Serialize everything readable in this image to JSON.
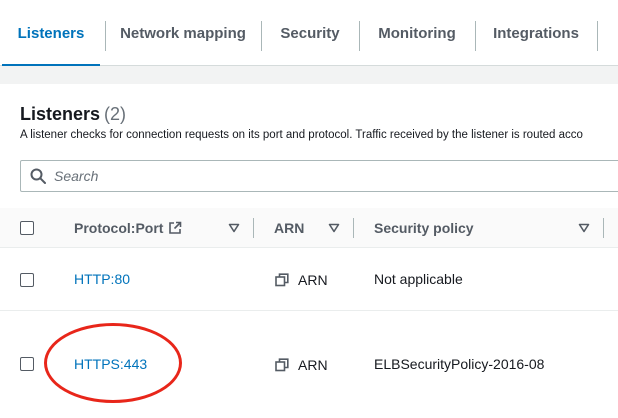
{
  "tabs": [
    {
      "label": "Listeners",
      "active": true
    },
    {
      "label": "Network mapping",
      "active": false
    },
    {
      "label": "Security",
      "active": false
    },
    {
      "label": "Monitoring",
      "active": false
    },
    {
      "label": "Integrations",
      "active": false
    }
  ],
  "listeners": {
    "title": "Listeners",
    "count": "(2)",
    "description": "A listener checks for connection requests on its port and protocol. Traffic received by the listener is routed acco",
    "search_placeholder": "Search"
  },
  "table": {
    "columns": {
      "protocol_port": "Protocol:Port",
      "arn": "ARN",
      "security_policy": "Security policy"
    },
    "rows": [
      {
        "protocol_port": "HTTP:80",
        "arn": "ARN",
        "security_policy": "Not applicable"
      },
      {
        "protocol_port": "HTTPS:443",
        "arn": "ARN",
        "security_policy": "ELBSecurityPolicy-2016-08"
      }
    ]
  },
  "icons": {
    "search": "search-icon",
    "external_link": "external-link-icon",
    "sort": "caret-down-icon",
    "copy": "copy-icon"
  },
  "colors": {
    "link": "#0073bb",
    "annotation": "#e8261a"
  }
}
